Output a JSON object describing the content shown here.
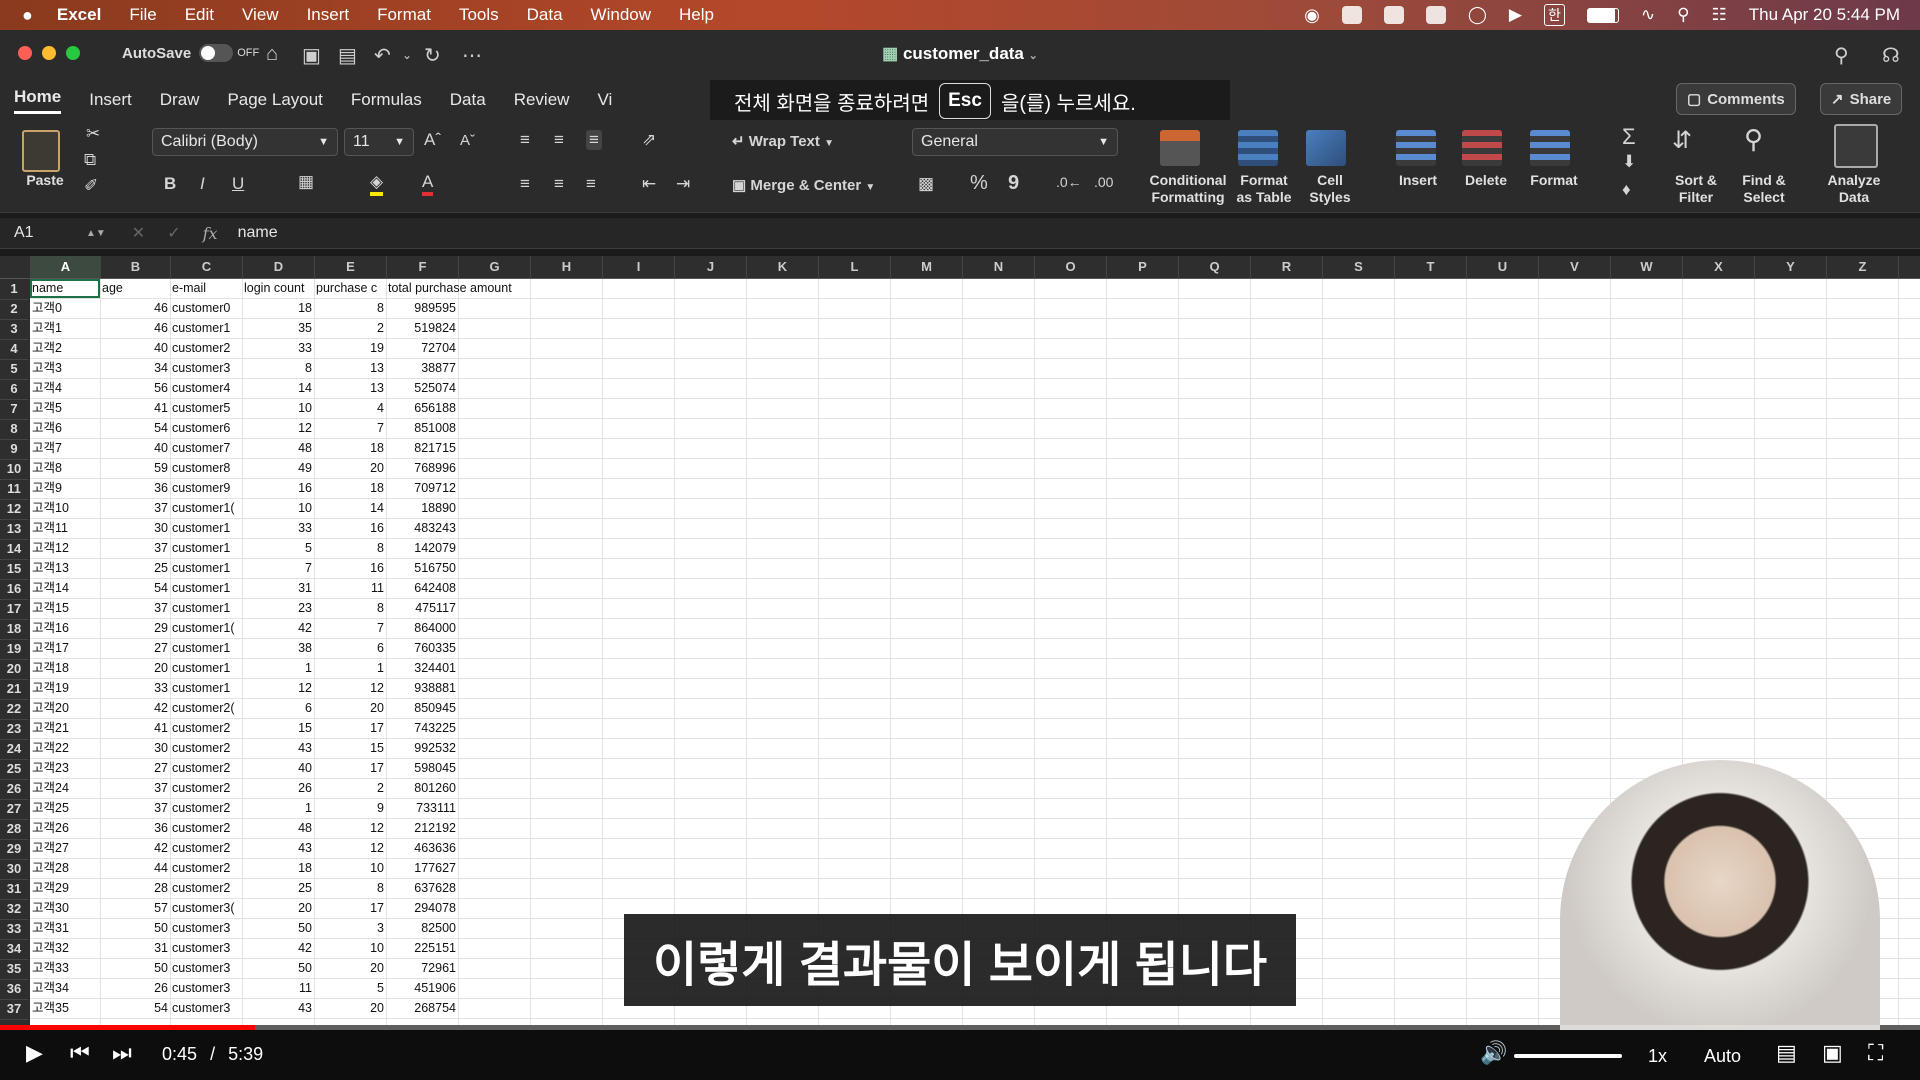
{
  "menubar": {
    "apple": "",
    "app": "Excel",
    "items": [
      "File",
      "Edit",
      "View",
      "Insert",
      "Format",
      "Tools",
      "Data",
      "Window",
      "Help"
    ],
    "ime": "한",
    "clock": "Thu Apr 20  5:44 PM"
  },
  "titlebar": {
    "autosave_label": "AutoSave",
    "autosave_state": "OFF",
    "doc_title": "customer_data"
  },
  "ribbon_tabs": [
    "Home",
    "Insert",
    "Draw",
    "Page Layout",
    "Formulas",
    "Data",
    "Review",
    "Vi"
  ],
  "toast": {
    "before": "전체 화면을 종료하려면",
    "key": "Esc",
    "after": "을(를) 누르세요."
  },
  "comments_label": "Comments",
  "share_label": "Share",
  "ribbon": {
    "paste": "Paste",
    "font_name": "Calibri (Body)",
    "font_size": "11",
    "bold": "B",
    "italic": "I",
    "underline": "U",
    "wrap_text": "Wrap Text",
    "merge_center": "Merge & Center",
    "number_format": "General",
    "percent": "%",
    "comma": "9",
    "cond_format": [
      "Conditional",
      "Formatting"
    ],
    "format_table": [
      "Format",
      "as Table"
    ],
    "cell_styles": [
      "Cell",
      "Styles"
    ],
    "insert": "Insert",
    "delete": "Delete",
    "format": "Format",
    "sort_filter": [
      "Sort &",
      "Filter"
    ],
    "find_select": [
      "Find &",
      "Select"
    ],
    "analyze": [
      "Analyze",
      "Data"
    ]
  },
  "formula_bar": {
    "cell_ref": "A1",
    "fx": "fx",
    "content": "name"
  },
  "columns": [
    "A",
    "B",
    "C",
    "D",
    "E",
    "F",
    "G",
    "H",
    "I",
    "J",
    "K",
    "L",
    "M",
    "N",
    "O",
    "P",
    "Q",
    "R",
    "S",
    "T",
    "U",
    "V",
    "W",
    "X",
    "Y",
    "Z",
    "AA"
  ],
  "header_row": [
    "name",
    "age",
    "e-mail",
    "login count",
    "purchase c",
    "total purchase amount"
  ],
  "rows": [
    [
      "고객0",
      "46",
      "customer0",
      "18",
      "8",
      "989595"
    ],
    [
      "고객1",
      "46",
      "customer1",
      "35",
      "2",
      "519824"
    ],
    [
      "고객2",
      "40",
      "customer2",
      "33",
      "19",
      "72704"
    ],
    [
      "고객3",
      "34",
      "customer3",
      "8",
      "13",
      "38877"
    ],
    [
      "고객4",
      "56",
      "customer4",
      "14",
      "13",
      "525074"
    ],
    [
      "고객5",
      "41",
      "customer5",
      "10",
      "4",
      "656188"
    ],
    [
      "고객6",
      "54",
      "customer6",
      "12",
      "7",
      "851008"
    ],
    [
      "고객7",
      "40",
      "customer7",
      "48",
      "18",
      "821715"
    ],
    [
      "고객8",
      "59",
      "customer8",
      "49",
      "20",
      "768996"
    ],
    [
      "고객9",
      "36",
      "customer9",
      "16",
      "18",
      "709712"
    ],
    [
      "고객10",
      "37",
      "customer1(",
      "10",
      "14",
      "18890"
    ],
    [
      "고객11",
      "30",
      "customer1",
      "33",
      "16",
      "483243"
    ],
    [
      "고객12",
      "37",
      "customer1",
      "5",
      "8",
      "142079"
    ],
    [
      "고객13",
      "25",
      "customer1",
      "7",
      "16",
      "516750"
    ],
    [
      "고객14",
      "54",
      "customer1",
      "31",
      "11",
      "642408"
    ],
    [
      "고객15",
      "37",
      "customer1",
      "23",
      "8",
      "475117"
    ],
    [
      "고객16",
      "29",
      "customer1(",
      "42",
      "7",
      "864000"
    ],
    [
      "고객17",
      "27",
      "customer1",
      "38",
      "6",
      "760335"
    ],
    [
      "고객18",
      "20",
      "customer1",
      "1",
      "1",
      "324401"
    ],
    [
      "고객19",
      "33",
      "customer1",
      "12",
      "12",
      "938881"
    ],
    [
      "고객20",
      "42",
      "customer2(",
      "6",
      "20",
      "850945"
    ],
    [
      "고객21",
      "41",
      "customer2",
      "15",
      "17",
      "743225"
    ],
    [
      "고객22",
      "30",
      "customer2",
      "43",
      "15",
      "992532"
    ],
    [
      "고객23",
      "27",
      "customer2",
      "40",
      "17",
      "598045"
    ],
    [
      "고객24",
      "37",
      "customer2",
      "26",
      "2",
      "801260"
    ],
    [
      "고객25",
      "37",
      "customer2",
      "1",
      "9",
      "733111"
    ],
    [
      "고객26",
      "36",
      "customer2",
      "48",
      "12",
      "212192"
    ],
    [
      "고객27",
      "42",
      "customer2",
      "43",
      "12",
      "463636"
    ],
    [
      "고객28",
      "44",
      "customer2",
      "18",
      "10",
      "177627"
    ],
    [
      "고객29",
      "28",
      "customer2",
      "25",
      "8",
      "637628"
    ],
    [
      "고객30",
      "57",
      "customer3(",
      "20",
      "17",
      "294078"
    ],
    [
      "고객31",
      "50",
      "customer3",
      "50",
      "3",
      "82500"
    ],
    [
      "고객32",
      "31",
      "customer3",
      "42",
      "10",
      "225151"
    ],
    [
      "고객33",
      "50",
      "customer3",
      "50",
      "20",
      "72961"
    ],
    [
      "고객34",
      "26",
      "customer3",
      "11",
      "5",
      "451906"
    ],
    [
      "고객35",
      "54",
      "customer3",
      "43",
      "20",
      "268754"
    ]
  ],
  "subtitle": "이렇게 결과물이 보이게 됩니다",
  "player": {
    "current_time": "0:45",
    "separator": "/",
    "duration": "5:39",
    "progress_fraction": 0.133,
    "speed": "1x",
    "quality": "Auto"
  },
  "colors": {
    "excel_green": "#1e7145",
    "progress_red": "#ff0000"
  }
}
